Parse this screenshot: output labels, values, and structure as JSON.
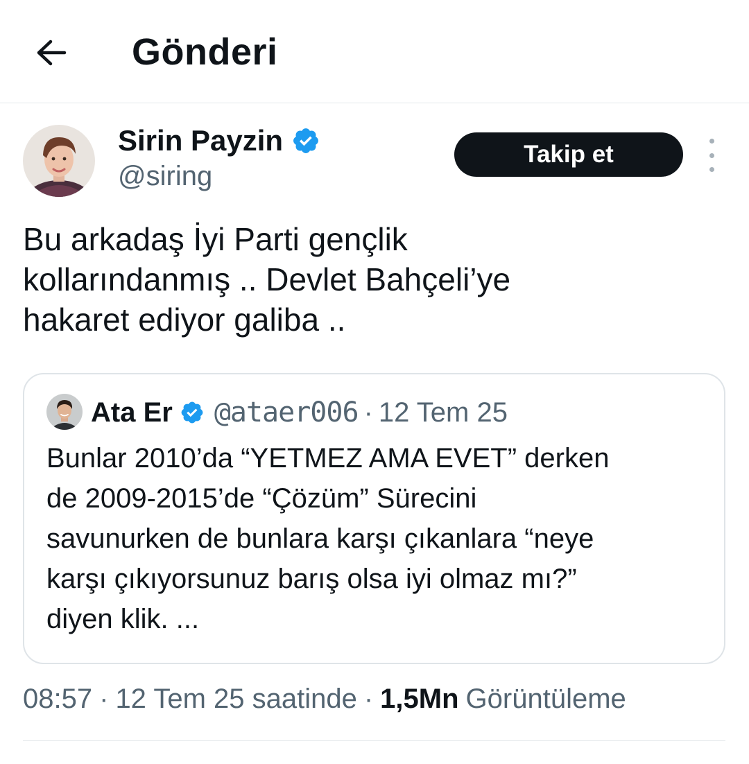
{
  "header": {
    "title": "Gönderi",
    "back_icon": "arrow-left-icon"
  },
  "author": {
    "name": "Sirin Payzin",
    "handle": "@siring",
    "verified": true,
    "follow_label": "Takip et"
  },
  "tweet": {
    "text": "Bu arkadaş İyi Parti  gençlik\nkollarındanmış .. Devlet Bahçeli’ye\nhakaret ediyor galiba .."
  },
  "quoted": {
    "name": "Ata Er",
    "handle": "@ataer006",
    "separator": "·",
    "date": "12 Tem 25",
    "verified": true,
    "text": "Bunlar 2010’da “YETMEZ AMA EVET” derken\nde 2009-2015’de “Çözüm” Sürecini\nsavunurken de bunlara karşı çıkanlara “neye\nkarşı çıkıyorsunuz barış olsa iyi olmaz mı?”\ndiyen klik. ..."
  },
  "meta": {
    "time": "08:57",
    "separator": "·",
    "date": "12 Tem 25 saatinde",
    "views_count": "1,5Mn",
    "views_label": "Görüntüleme"
  },
  "colors": {
    "verified": "#1d9bf0",
    "follow_bg": "#0f1419",
    "muted": "#536471"
  }
}
